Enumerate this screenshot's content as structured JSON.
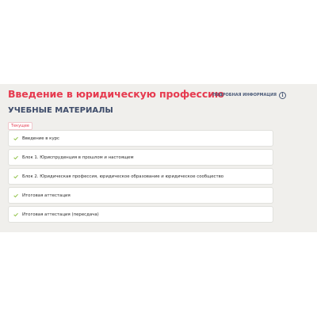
{
  "course": {
    "title": "Введение в юридическую профессию",
    "details_link": "ПОДРОБНАЯ ИНФОРМАЦИЯ"
  },
  "materials": {
    "section_title": "УЧЕБНЫЕ МАТЕРИАЛЫ",
    "tag": "Текущее",
    "items": [
      {
        "label": "Введение в курс",
        "completed": true
      },
      {
        "label": "Блок 1. Юриспруденция в прошлом и настоящем",
        "completed": true
      },
      {
        "label": "Блок 2. Юридическая профессия, юридическое образование и юридическое сообщество",
        "completed": true
      },
      {
        "label": "Итоговая аттестация",
        "completed": true
      },
      {
        "label": "Итоговая аттестация (пересдача)",
        "completed": true
      }
    ]
  },
  "colors": {
    "accent": "#e63a4f",
    "heading": "#3e4c6a",
    "check": "#8bbf3f",
    "panel_bg": "#f0efec"
  },
  "icons": {
    "info": "info-icon",
    "check": "checkmark-icon"
  }
}
